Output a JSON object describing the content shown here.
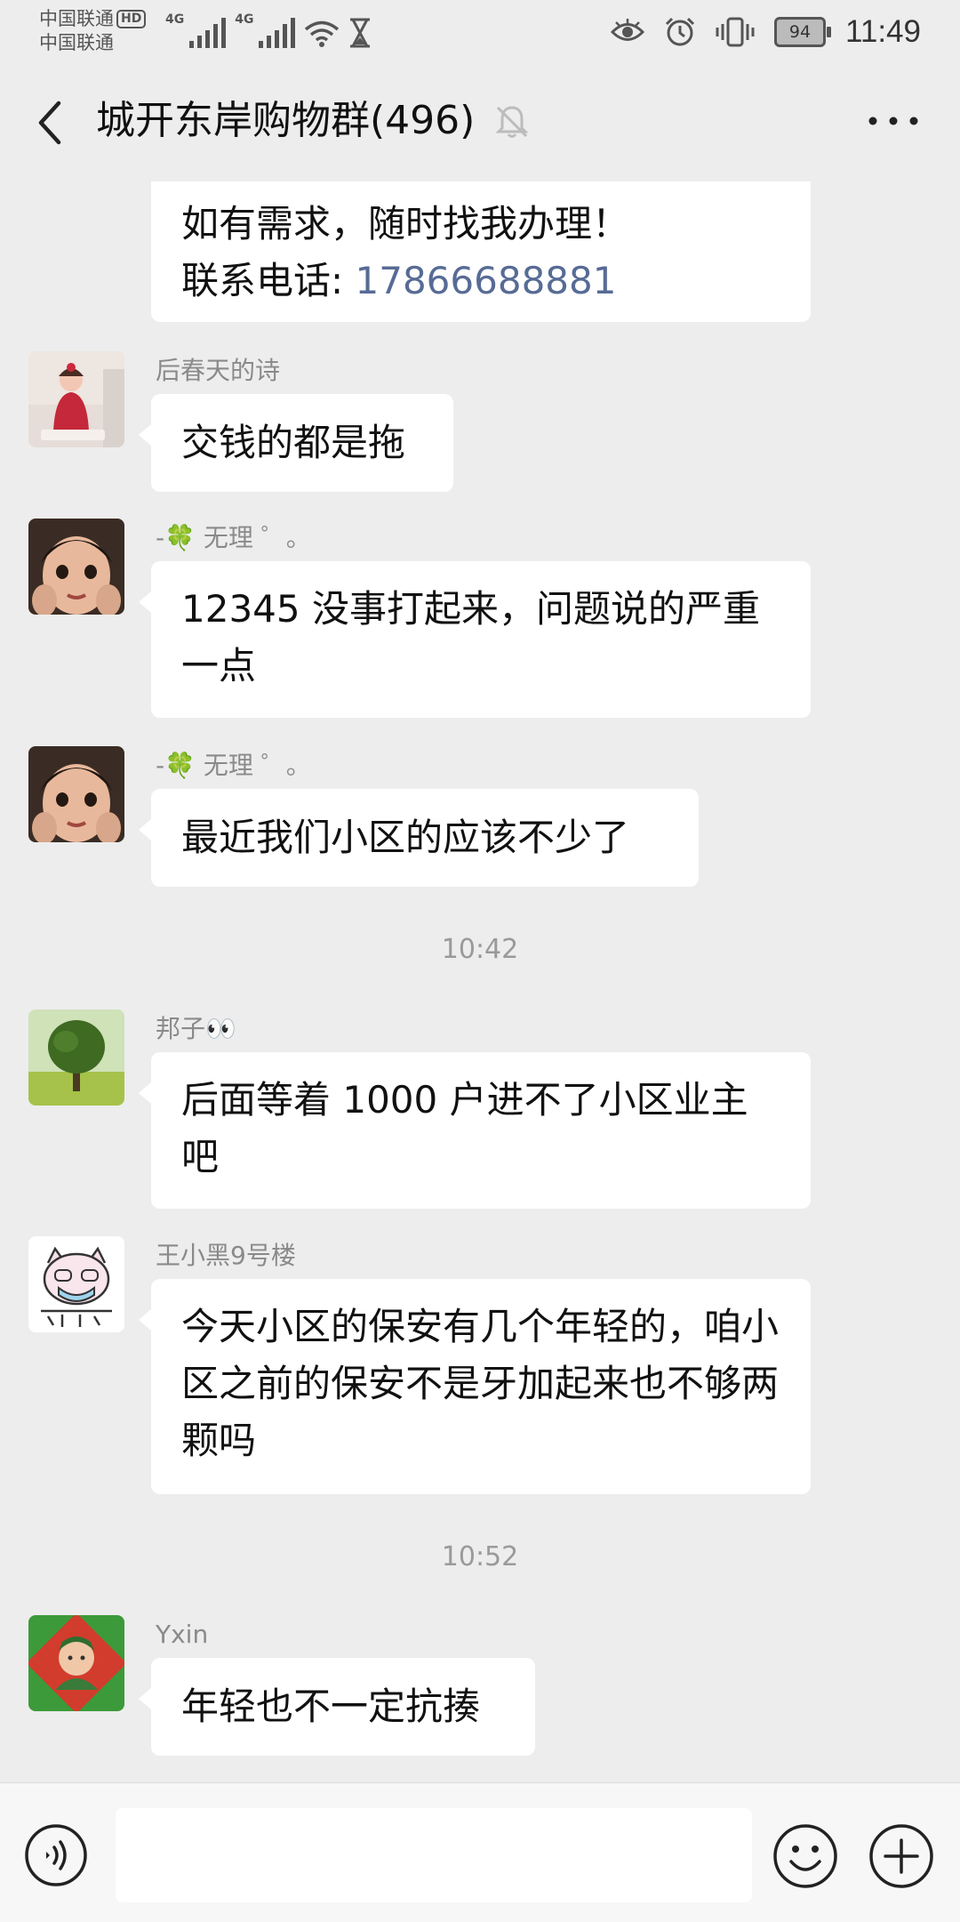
{
  "status_bar": {
    "carrier_1": "中国联通",
    "hd": "HD",
    "carrier_2": "中国联通",
    "net_1": "4G",
    "net_2": "4G",
    "battery": "94",
    "time": "11:49"
  },
  "header": {
    "title": "城开东岸购物群(496)"
  },
  "messages": [
    {
      "line1": "如有需求，随时找我办理！",
      "line2_prefix": "联系电话: ",
      "phone": "17866688881"
    },
    {
      "sender": "后春天的诗",
      "text": "交钱的都是拖"
    },
    {
      "sender": "-🍀 无理 ゜。",
      "text": "12345 没事打起来，问题说的严重一点"
    },
    {
      "sender": "-🍀 无理 ゜。",
      "text": "最近我们小区的应该不少了"
    },
    {
      "sender": "邦子👀",
      "text": "后面等着 1000 户进不了小区业主吧"
    },
    {
      "sender": "王小黑9号楼",
      "text": "今天小区的保安有几个年轻的，咱小区之前的保安不是牙加起来也不够两颗吗"
    },
    {
      "sender": "Yxin",
      "text": "年轻也不一定抗揍"
    }
  ],
  "timestamps": [
    "10:42",
    "10:52"
  ],
  "colors": {
    "background": "#ededed",
    "bubble": "#ffffff",
    "link": "#576b95"
  },
  "icons": {
    "back": "chevron-left-icon",
    "mute": "bell-off-icon",
    "more": "more-icon",
    "voice": "voice-icon",
    "emoji": "emoji-icon",
    "plus": "plus-icon"
  }
}
